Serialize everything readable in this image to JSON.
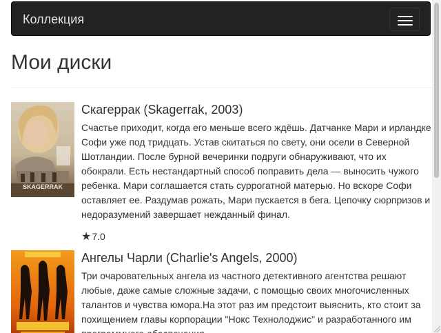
{
  "navbar": {
    "brand": "Коллекция",
    "menu_icon": "hamburger-menu-icon"
  },
  "page": {
    "title": "Мои диски"
  },
  "movies": [
    {
      "title": "Скагеррак (Skagerrak, 2003)",
      "description": "Счастье приходит, когда его меньше всего ждёшь. Датчанке Мари и ирландке Софи уже под тридцать. Устав скитаться по свету, они осели в Северной Шотландии. После бурной вечеринки подруги обнаруживают, что их обокрали. Есть нестандартный способ поправить дела — выносить чужого ребенка. Мари соглашается стать суррогатной матерью. Но вскоре Софи оставляет ее. Раздумав рожать, Мари пускается в бега. Цепочку сюрпризов и недоразумений завершает нежданный финал.",
      "rating_icon": "★",
      "rating": "7.0",
      "poster_text": "SKAGERRAK"
    },
    {
      "title": "Ангелы Чарли (Charlie's Angels, 2000)",
      "description": "Три очаровательных ангела из частного детективного агентства решают любые, даже самые сложные задачи, с помощью своих многочисленных талантов и чувства юмора.На этот раз им предстоит выяснить, кто стоит за похищением главы корпорации \"Нокс Технолоджис\" и разработанного им программного обеспечения."
    }
  ],
  "colors": {
    "navbar_bg": "#222222",
    "navbar_text": "#e6e6e6",
    "text": "#333333",
    "divider": "#eeeeee"
  }
}
